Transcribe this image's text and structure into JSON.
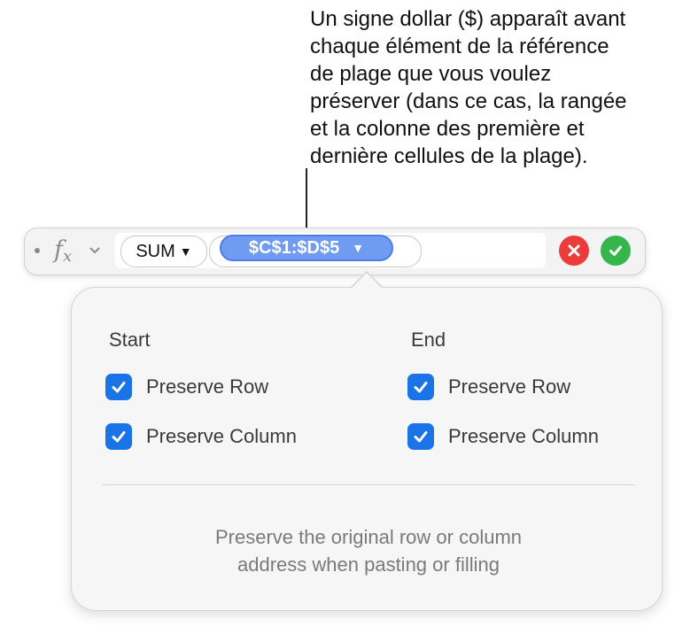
{
  "annotation": {
    "callout_text": "Un signe dollar ($) apparaît avant\nchaque élément de la référence\nde plage que vous voulez\npréserver (dans ce cas, la rangée\net la colonne des première et\ndernière cellules de la plage)."
  },
  "formula_bar": {
    "fx_label": "f",
    "fx_sub": "x",
    "chevron_icon": "chevron-down-icon",
    "function_token": "SUM",
    "token_caret": "▼",
    "range_token": "$C$1:$D$5",
    "cancel_icon": "close-icon",
    "accept_icon": "checkmark-icon",
    "colors": {
      "cancel": "#ec3b3b",
      "accept": "#36b54a",
      "range_token": "#6f9bf2"
    }
  },
  "popover": {
    "start": {
      "title": "Start",
      "preserve_row": {
        "label": "Preserve Row",
        "checked": true
      },
      "preserve_column": {
        "label": "Preserve Column",
        "checked": true
      }
    },
    "end": {
      "title": "End",
      "preserve_row": {
        "label": "Preserve Row",
        "checked": true
      },
      "preserve_column": {
        "label": "Preserve Column",
        "checked": true
      }
    },
    "help_text": "Preserve the original row or column\naddress when pasting or filling",
    "colors": {
      "checkbox": "#1a74e8"
    }
  }
}
